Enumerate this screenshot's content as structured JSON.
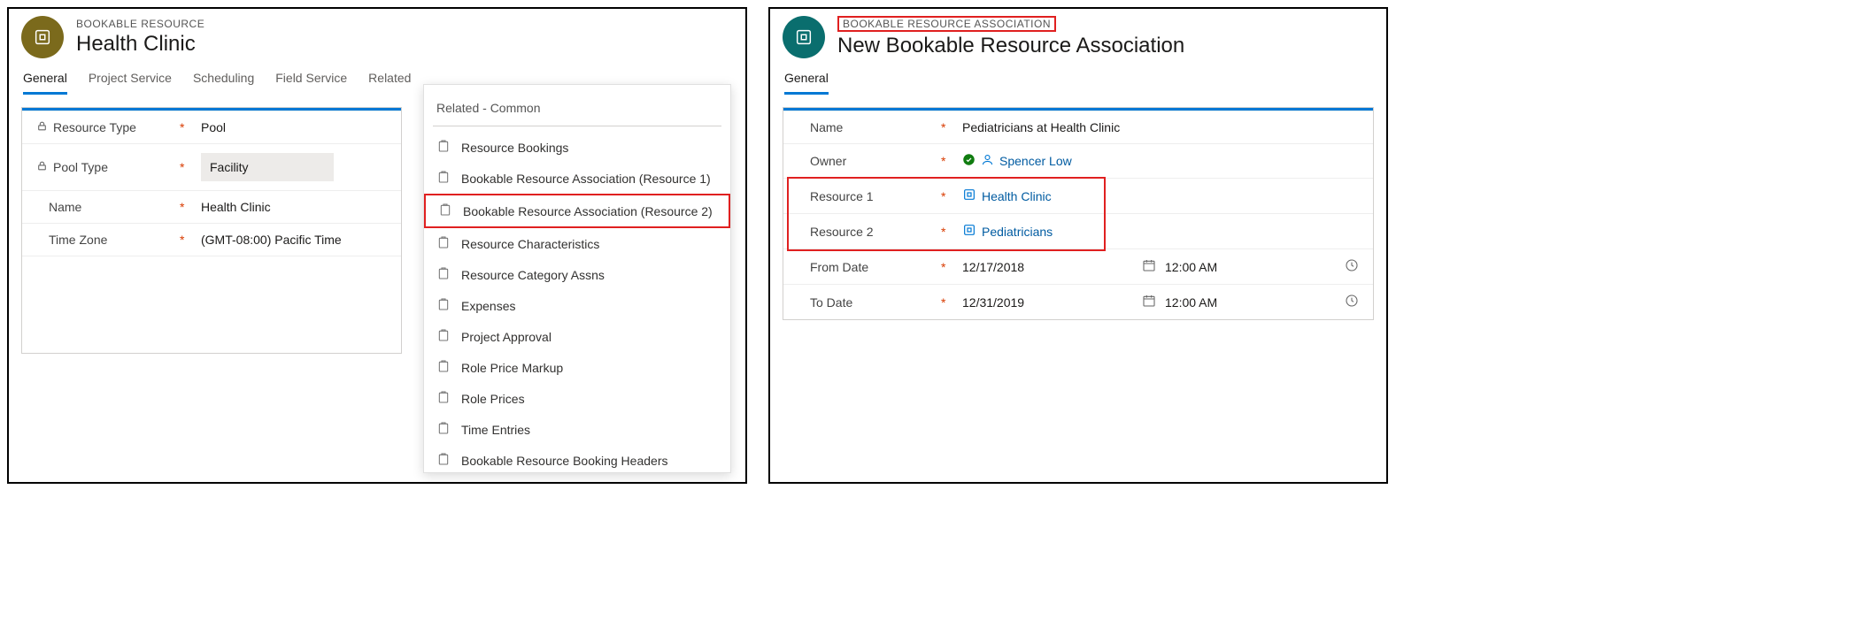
{
  "left": {
    "entity_label": "BOOKABLE RESOURCE",
    "entity_title": "Health Clinic",
    "tabs": [
      "General",
      "Project Service",
      "Scheduling",
      "Field Service",
      "Related"
    ],
    "active_tab": "General",
    "fields": {
      "resource_type": {
        "label": "Resource Type",
        "value": "Pool",
        "required": true,
        "locked": true
      },
      "pool_type": {
        "label": "Pool Type",
        "value": "Facility",
        "required": true,
        "locked": true
      },
      "name": {
        "label": "Name",
        "value": "Health Clinic",
        "required": true
      },
      "time_zone": {
        "label": "Time Zone",
        "value": "(GMT-08:00) Pacific Time",
        "required": true
      }
    },
    "related": {
      "section": "Related - Common",
      "items": [
        "Resource Bookings",
        "Bookable Resource Association (Resource 1)",
        "Bookable Resource Association (Resource 2)",
        "Resource Characteristics",
        "Resource Category Assns",
        "Expenses",
        "Project Approval",
        "Role Price Markup",
        "Role Prices",
        "Time Entries",
        "Bookable Resource Booking Headers"
      ],
      "highlighted_index": 2
    }
  },
  "right": {
    "entity_label": "BOOKABLE RESOURCE ASSOCIATION",
    "entity_title": "New Bookable Resource Association",
    "tabs": [
      "General"
    ],
    "active_tab": "General",
    "fields": {
      "name": {
        "label": "Name",
        "value": "Pediatricians at Health Clinic",
        "required": true
      },
      "owner": {
        "label": "Owner",
        "value": "Spencer Low",
        "required": true
      },
      "resource1": {
        "label": "Resource 1",
        "value": "Health Clinic",
        "required": true
      },
      "resource2": {
        "label": "Resource 2",
        "value": "Pediatricians",
        "required": true
      },
      "from_date": {
        "label": "From Date",
        "date": "12/17/2018",
        "time": "12:00 AM",
        "required": true
      },
      "to_date": {
        "label": "To Date",
        "date": "12/31/2019",
        "time": "12:00 AM",
        "required": true
      }
    }
  }
}
